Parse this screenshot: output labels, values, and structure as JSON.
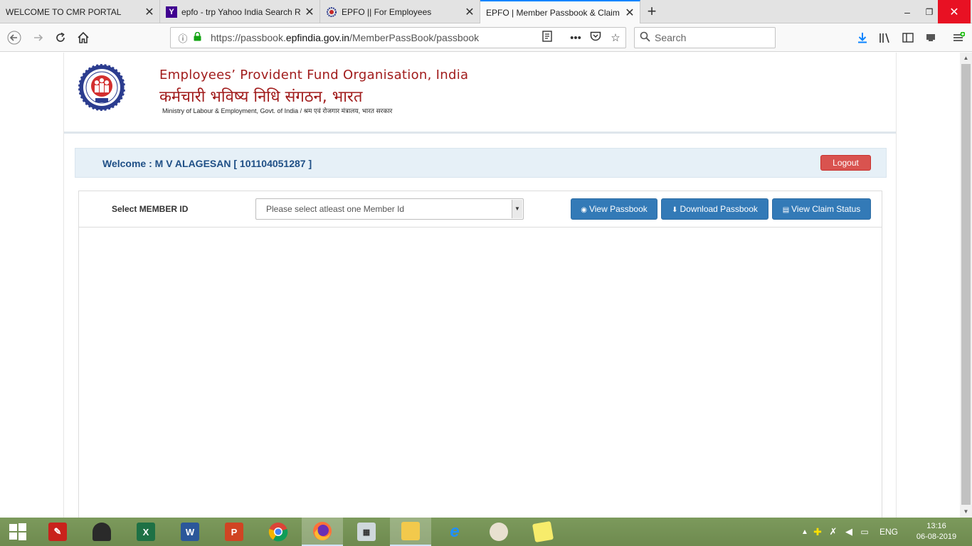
{
  "browser": {
    "tabs": [
      {
        "label": "WELCOME TO CMR PORTAL",
        "active": false
      },
      {
        "label": "epfo - trp Yahoo India Search R",
        "active": false
      },
      {
        "label": "EPFO || For Employees",
        "active": false
      },
      {
        "label": "EPFO | Member Passbook & Claim",
        "active": true
      }
    ],
    "url_prefix": "https://passbook.",
    "url_domain": "epfindia.gov.in",
    "url_path": "/MemberPassBook/passbook",
    "search_placeholder": "Search"
  },
  "header": {
    "org_english": "Employees’ Provident Fund Organisation, India",
    "org_hindi": "कर्मचारी भविष्य निधि संगठन, भारत",
    "ministry": "Ministry of Labour & Employment, Govt. of India / श्रम एवं रोजगार मंत्रालय, भारत सरकार"
  },
  "welcome": {
    "text": "Welcome : M V ALAGESAN [ 101104051287 ]",
    "logout_label": "Logout"
  },
  "member_panel": {
    "select_label": "Select MEMBER ID",
    "select_value": "Please select atleast one Member Id",
    "view_passbook_label": "View Passbook",
    "download_passbook_label": "Download Passbook",
    "view_claim_status_label": "View Claim Status"
  },
  "taskbar": {
    "apps": [
      "start",
      "acrobat",
      "user",
      "excel",
      "word",
      "powerpoint",
      "chrome",
      "firefox",
      "calculator",
      "file-explorer",
      "internet-explorer",
      "paint",
      "sticky-notes"
    ],
    "language": "ENG",
    "time": "13:16",
    "date": "06-08-2019"
  },
  "colors": {
    "brand_red": "#a11c1c",
    "button_blue": "#337ab7",
    "logout_red": "#d9534f",
    "welcome_text": "#1f4f86"
  }
}
